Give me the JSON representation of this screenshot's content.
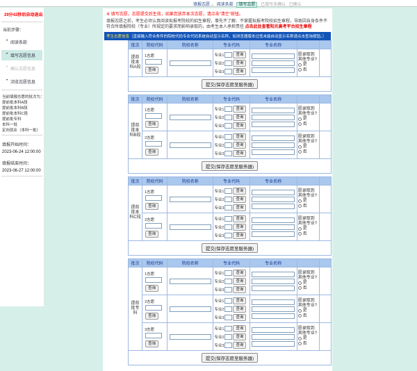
{
  "colors": {
    "page_teal": "#d7efe9",
    "banner_blue": "#1254b7",
    "header_blue": "#aac8ee",
    "alert_red": "#ff0000"
  },
  "topbar": {
    "prefix": "填报志愿→",
    "steps": [
      {
        "label": "阅读条款",
        "state": "normal"
      },
      {
        "label": "填写志愿",
        "state": "active"
      },
      {
        "label": "已填写未确认",
        "state": "dim"
      },
      {
        "label": "已确认",
        "state": "dim"
      }
    ]
  },
  "sidebar": {
    "logout_timer": "29分42秒后自动退出",
    "steps_title": "当前步骤：",
    "steps": [
      {
        "label": "阅读条款",
        "state": "normal"
      },
      {
        "label": "填写志愿信息",
        "state": "active"
      },
      {
        "label": "确认志愿信息",
        "state": "disabled"
      },
      {
        "label": "浏览志愿信息",
        "state": "normal"
      }
    ],
    "batches_title": "当前填报志愿的批次为：",
    "batches": [
      "提前批本科A段",
      "提前批本科B段",
      "提前批本科C段",
      "提前批专科",
      "本科一批",
      "定向就业（本科一批）"
    ],
    "start_label": "填报开始时间：",
    "start_time": "2023-06-24 12:00:00",
    "end_label": "填报结束时间：",
    "end_time": "2023-06-27 12:00:00"
  },
  "notices": {
    "line1": "※ 填写志愿，志愿提交后生效，如果您放弃本次志愿，请点击“清空”按钮。",
    "line2": "填报志愿之前，考生必须认真阅读拟报考院校的招生章程，事先不了解、不掌握拟报考院校招生章程，导致因自身条件不符合所填报院校（专业）所规定的要求而影响录取的，由考生本人承担责任 ",
    "line2_link": "点击此处查看阳光高考平台招生章程"
  },
  "banner": {
    "lead": "考生志愿信息",
    "rest": "（直接输入符合条件的院校代码专业代码系统自动显示名称，如浏览器版本过低未能自动显示名称请点击查询按钮。）"
  },
  "table": {
    "headers": [
      "批次",
      "院校代码",
      "院校名称",
      "专业代码",
      "专业名称"
    ],
    "query_label": "查询",
    "major_labels": [
      "专业1",
      "专业2",
      "专业3"
    ],
    "adjust_question": "愿录取到其他专业?",
    "adjust_yes": "是",
    "adjust_no": "否",
    "submit_label": "提交(保存志愿至服务器)"
  },
  "sections": [
    {
      "batch": "提前批本科A段",
      "volunteers": [
        "1志愿"
      ]
    },
    {
      "batch": "提前批本科B段",
      "volunteers": [
        "1志愿",
        "2志愿"
      ]
    },
    {
      "batch": "提前批本科C段",
      "volunteers": [
        "1志愿",
        "2志愿"
      ]
    },
    {
      "batch": "提前批专科",
      "volunteers": [
        "1志愿",
        "2志愿",
        "3志愿"
      ]
    }
  ]
}
